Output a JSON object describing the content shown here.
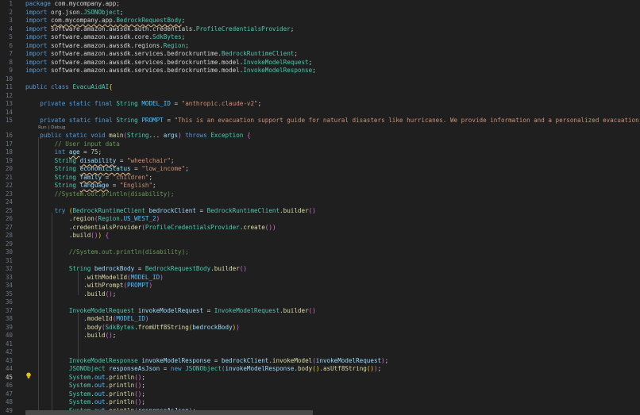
{
  "editor": {
    "codelens": "Run | Debug",
    "active_line": "45",
    "lines": [
      {
        "n": "1",
        "t": [
          [
            "kw",
            "package "
          ],
          [
            "pun",
            "com.mycompany.app;"
          ]
        ]
      },
      {
        "n": "2",
        "t": [
          [
            "kw",
            "import "
          ],
          [
            "pun",
            "org.json."
          ],
          [
            "ty",
            "JSONObject"
          ],
          [
            "pun",
            ";"
          ]
        ]
      },
      {
        "n": "3",
        "t": [
          [
            "kw",
            "import "
          ],
          [
            "squig",
            "com.mycompany.app."
          ],
          [
            "ty squig",
            "BedrockRequestBody"
          ],
          [
            "pun",
            ";"
          ]
        ]
      },
      {
        "n": "4",
        "t": [
          [
            "kw",
            "import "
          ],
          [
            "pun",
            "software.amazon.awssdk.auth.credentials."
          ],
          [
            "ty",
            "ProfileCredentialsProvider"
          ],
          [
            "pun",
            ";"
          ]
        ]
      },
      {
        "n": "5",
        "t": [
          [
            "kw",
            "import "
          ],
          [
            "pun",
            "software.amazon.awssdk.core."
          ],
          [
            "ty",
            "SdkBytes"
          ],
          [
            "pun",
            ";"
          ]
        ]
      },
      {
        "n": "6",
        "t": [
          [
            "kw",
            "import "
          ],
          [
            "pun",
            "software.amazon.awssdk.regions."
          ],
          [
            "ty",
            "Region"
          ],
          [
            "pun",
            ";"
          ]
        ]
      },
      {
        "n": "7",
        "t": [
          [
            "kw",
            "import "
          ],
          [
            "pun",
            "software.amazon.awssdk.services.bedrockruntime."
          ],
          [
            "ty",
            "BedrockRuntimeClient"
          ],
          [
            "pun",
            ";"
          ]
        ]
      },
      {
        "n": "8",
        "t": [
          [
            "kw",
            "import "
          ],
          [
            "pun",
            "software.amazon.awssdk.services.bedrockruntime.model."
          ],
          [
            "ty",
            "InvokeModelRequest"
          ],
          [
            "pun",
            ";"
          ]
        ]
      },
      {
        "n": "9",
        "t": [
          [
            "kw",
            "import "
          ],
          [
            "pun",
            "software.amazon.awssdk.services.bedrockruntime.model."
          ],
          [
            "ty",
            "InvokeModelResponse"
          ],
          [
            "pun",
            ";"
          ]
        ]
      },
      {
        "n": "10",
        "t": []
      },
      {
        "n": "11",
        "t": [
          [
            "kw",
            "public class "
          ],
          [
            "ty",
            "EvacuAidAI"
          ],
          [
            "brace",
            "{"
          ]
        ]
      },
      {
        "n": "12",
        "t": []
      },
      {
        "n": "13",
        "t": [
          [
            "pun",
            "    "
          ],
          [
            "kw",
            "private static final "
          ],
          [
            "ty",
            "String "
          ],
          [
            "cst",
            "MODEL_ID"
          ],
          [
            "pun",
            " = "
          ],
          [
            "str",
            "\"anthropic.claude-v2\""
          ],
          [
            "pun",
            ";"
          ]
        ]
      },
      {
        "n": "14",
        "t": []
      },
      {
        "n": "15",
        "t": [
          [
            "pun",
            "    "
          ],
          [
            "kw",
            "private static final "
          ],
          [
            "ty",
            "String "
          ],
          [
            "cst",
            "PROMPT"
          ],
          [
            "pun",
            " = "
          ],
          [
            "str",
            "\"This is an evacuation support guide for natural disasters like hurricanes. We provide information and a personalized evacuation plan based on"
          ]
        ]
      },
      {
        "n": "16",
        "t": [
          [
            "pun",
            "    "
          ],
          [
            "kw",
            "public static void "
          ],
          [
            "fn",
            "main"
          ],
          [
            "paren",
            "("
          ],
          [
            "ty",
            "String"
          ],
          [
            "pun",
            "... "
          ],
          [
            "var",
            "args"
          ],
          [
            "paren",
            ")"
          ],
          [
            "kw",
            " throws "
          ],
          [
            "ty",
            "Exception "
          ],
          [
            "paren",
            "{"
          ]
        ]
      },
      {
        "n": "17",
        "t": [
          [
            "pun",
            "        "
          ],
          [
            "cm",
            "// User input data"
          ]
        ]
      },
      {
        "n": "18",
        "t": [
          [
            "pun",
            "        "
          ],
          [
            "kw",
            "int "
          ],
          [
            "var squig",
            "age"
          ],
          [
            "pun",
            " = "
          ],
          [
            "num",
            "75"
          ],
          [
            "pun",
            ";"
          ]
        ]
      },
      {
        "n": "19",
        "t": [
          [
            "pun",
            "        "
          ],
          [
            "ty",
            "String "
          ],
          [
            "var squig",
            "disability"
          ],
          [
            "pun",
            " = "
          ],
          [
            "str",
            "\"wheelchair\""
          ],
          [
            "pun",
            ";"
          ]
        ]
      },
      {
        "n": "20",
        "t": [
          [
            "pun",
            "        "
          ],
          [
            "ty",
            "String "
          ],
          [
            "var squig",
            "economicStatus"
          ],
          [
            "pun",
            " = "
          ],
          [
            "str",
            "\"low_income\""
          ],
          [
            "pun",
            ";"
          ]
        ]
      },
      {
        "n": "21",
        "t": [
          [
            "pun",
            "        "
          ],
          [
            "ty",
            "String "
          ],
          [
            "var squig",
            "family"
          ],
          [
            "pun",
            " = "
          ],
          [
            "str",
            "\"children\""
          ],
          [
            "pun",
            ";"
          ]
        ]
      },
      {
        "n": "22",
        "t": [
          [
            "pun",
            "        "
          ],
          [
            "ty",
            "String "
          ],
          [
            "var squig",
            "language"
          ],
          [
            "pun",
            " = "
          ],
          [
            "str",
            "\"English\""
          ],
          [
            "pun",
            ";"
          ]
        ]
      },
      {
        "n": "23",
        "t": [
          [
            "pun",
            "        "
          ],
          [
            "cm",
            "//System.out.println(disability);"
          ]
        ]
      },
      {
        "n": "24",
        "t": []
      },
      {
        "n": "25",
        "t": [
          [
            "pun",
            "        "
          ],
          [
            "kw",
            "try "
          ],
          [
            "brace",
            "("
          ],
          [
            "ty",
            "BedrockRuntimeClient "
          ],
          [
            "var",
            "bedrockClient"
          ],
          [
            "pun",
            " = "
          ],
          [
            "ty",
            "BedrockRuntimeClient"
          ],
          [
            "pun",
            "."
          ],
          [
            "fn",
            "builder"
          ],
          [
            "paren",
            "()"
          ]
        ]
      },
      {
        "n": "26",
        "t": [
          [
            "pun",
            "            ."
          ],
          [
            "fn",
            "region"
          ],
          [
            "paren",
            "("
          ],
          [
            "ty",
            "Region"
          ],
          [
            "pun",
            "."
          ],
          [
            "cst",
            "US_WEST_2"
          ],
          [
            "paren",
            ")"
          ]
        ]
      },
      {
        "n": "27",
        "t": [
          [
            "pun",
            "            ."
          ],
          [
            "fn",
            "credentialsProvider"
          ],
          [
            "paren",
            "("
          ],
          [
            "ty",
            "ProfileCredentialsProvider"
          ],
          [
            "pun",
            "."
          ],
          [
            "fn",
            "create"
          ],
          [
            "paren",
            "()"
          ],
          [
            "paren",
            ")"
          ]
        ]
      },
      {
        "n": "28",
        "t": [
          [
            "pun",
            "            ."
          ],
          [
            "fn",
            "build"
          ],
          [
            "paren",
            "()"
          ],
          [
            "brace",
            ")"
          ],
          [
            "pun",
            " "
          ],
          [
            "paren",
            "{"
          ]
        ]
      },
      {
        "n": "29",
        "t": []
      },
      {
        "n": "30",
        "t": [
          [
            "pun",
            "            "
          ],
          [
            "cm",
            "//System.out.println(disability);"
          ]
        ]
      },
      {
        "n": "31",
        "t": []
      },
      {
        "n": "32",
        "t": [
          [
            "pun",
            "            "
          ],
          [
            "ty",
            "String "
          ],
          [
            "var",
            "bedrockBody"
          ],
          [
            "pun",
            " = "
          ],
          [
            "ty",
            "BedrockRequestBody"
          ],
          [
            "pun",
            "."
          ],
          [
            "fn",
            "builder"
          ],
          [
            "paren",
            "()"
          ]
        ]
      },
      {
        "n": "33",
        "t": [
          [
            "pun",
            "                ."
          ],
          [
            "fn",
            "withModelId"
          ],
          [
            "paren",
            "("
          ],
          [
            "cst",
            "MODEL_ID"
          ],
          [
            "paren",
            ")"
          ]
        ]
      },
      {
        "n": "34",
        "t": [
          [
            "pun",
            "                ."
          ],
          [
            "fn",
            "withPrompt"
          ],
          [
            "paren",
            "("
          ],
          [
            "cst",
            "PROMPT"
          ],
          [
            "paren",
            ")"
          ]
        ]
      },
      {
        "n": "35",
        "t": [
          [
            "pun",
            "                ."
          ],
          [
            "fn",
            "build"
          ],
          [
            "paren",
            "()"
          ],
          [
            "pun",
            ";"
          ]
        ]
      },
      {
        "n": "36",
        "t": []
      },
      {
        "n": "37",
        "t": [
          [
            "pun",
            "            "
          ],
          [
            "ty",
            "InvokeModelRequest "
          ],
          [
            "var",
            "invokeModelRequest"
          ],
          [
            "pun",
            " = "
          ],
          [
            "ty",
            "InvokeModelRequest"
          ],
          [
            "pun",
            "."
          ],
          [
            "fn",
            "builder"
          ],
          [
            "paren",
            "()"
          ]
        ]
      },
      {
        "n": "38",
        "t": [
          [
            "pun",
            "                ."
          ],
          [
            "fn",
            "modelId"
          ],
          [
            "paren",
            "("
          ],
          [
            "cst",
            "MODEL_ID"
          ],
          [
            "paren",
            ")"
          ]
        ]
      },
      {
        "n": "39",
        "t": [
          [
            "pun",
            "                ."
          ],
          [
            "fn",
            "body"
          ],
          [
            "paren",
            "("
          ],
          [
            "ty",
            "SdkBytes"
          ],
          [
            "pun",
            "."
          ],
          [
            "fn",
            "fromUtf8String"
          ],
          [
            "brace",
            "("
          ],
          [
            "var",
            "bedrockBody"
          ],
          [
            "brace",
            ")"
          ],
          [
            "paren",
            ")"
          ]
        ]
      },
      {
        "n": "40",
        "t": [
          [
            "pun",
            "                ."
          ],
          [
            "fn",
            "build"
          ],
          [
            "paren",
            "()"
          ],
          [
            "pun",
            ";"
          ]
        ]
      },
      {
        "n": "41",
        "t": []
      },
      {
        "n": "42",
        "t": []
      },
      {
        "n": "43",
        "t": [
          [
            "pun",
            "            "
          ],
          [
            "ty",
            "InvokeModelResponse "
          ],
          [
            "var",
            "invokeModelResponse"
          ],
          [
            "pun",
            " = "
          ],
          [
            "var",
            "bedrockClient"
          ],
          [
            "pun",
            "."
          ],
          [
            "fn",
            "invokeModel"
          ],
          [
            "paren",
            "("
          ],
          [
            "var",
            "invokeModelRequest"
          ],
          [
            "paren",
            ")"
          ],
          [
            "pun",
            ";"
          ]
        ]
      },
      {
        "n": "44",
        "t": [
          [
            "pun",
            "            "
          ],
          [
            "ty",
            "JSONObject "
          ],
          [
            "var",
            "responseAsJson"
          ],
          [
            "pun",
            " = "
          ],
          [
            "kw",
            "new "
          ],
          [
            "ty",
            "JSONObject"
          ],
          [
            "paren",
            "("
          ],
          [
            "var",
            "invokeModelResponse"
          ],
          [
            "pun",
            "."
          ],
          [
            "fn",
            "body"
          ],
          [
            "brace",
            "()"
          ],
          [
            "pun",
            "."
          ],
          [
            "fn",
            "asUtf8String"
          ],
          [
            "brace",
            "()"
          ],
          [
            "paren",
            ")"
          ],
          [
            "pun",
            ";"
          ]
        ]
      },
      {
        "n": "45",
        "t": [
          [
            "pun",
            "            "
          ],
          [
            "ty",
            "System"
          ],
          [
            "pun",
            "."
          ],
          [
            "cst",
            "out"
          ],
          [
            "pun",
            "."
          ],
          [
            "fn",
            "println"
          ],
          [
            "paren",
            "()"
          ],
          [
            "pun",
            ";"
          ]
        ]
      },
      {
        "n": "46",
        "t": [
          [
            "pun",
            "            "
          ],
          [
            "ty",
            "System"
          ],
          [
            "pun",
            "."
          ],
          [
            "cst",
            "out"
          ],
          [
            "pun",
            "."
          ],
          [
            "fn",
            "println"
          ],
          [
            "paren",
            "()"
          ],
          [
            "pun",
            ";"
          ]
        ]
      },
      {
        "n": "47",
        "t": [
          [
            "pun",
            "            "
          ],
          [
            "ty",
            "System"
          ],
          [
            "pun",
            "."
          ],
          [
            "cst",
            "out"
          ],
          [
            "pun",
            "."
          ],
          [
            "fn",
            "println"
          ],
          [
            "paren",
            "()"
          ],
          [
            "pun",
            ";"
          ]
        ]
      },
      {
        "n": "48",
        "t": [
          [
            "pun",
            "            "
          ],
          [
            "ty",
            "System"
          ],
          [
            "pun",
            "."
          ],
          [
            "cst",
            "out"
          ],
          [
            "pun",
            "."
          ],
          [
            "fn",
            "println"
          ],
          [
            "paren",
            "()"
          ],
          [
            "pun",
            ";"
          ]
        ]
      },
      {
        "n": "49",
        "t": [
          [
            "pun",
            "            "
          ],
          [
            "ty",
            "System"
          ],
          [
            "pun",
            "."
          ],
          [
            "cst",
            "out"
          ],
          [
            "pun",
            "."
          ],
          [
            "fn",
            "println"
          ],
          [
            "paren",
            "("
          ],
          [
            "var",
            "responseAsJson"
          ],
          [
            "paren",
            ")"
          ],
          [
            "pun",
            ";"
          ]
        ]
      }
    ]
  },
  "colors": {
    "background": "#1f1f1f",
    "keyword": "#569cd6",
    "type": "#4ec9b0",
    "string": "#ce9178",
    "comment": "#6a9955"
  },
  "icons": {
    "lightbulb": "lightbulb-icon"
  }
}
